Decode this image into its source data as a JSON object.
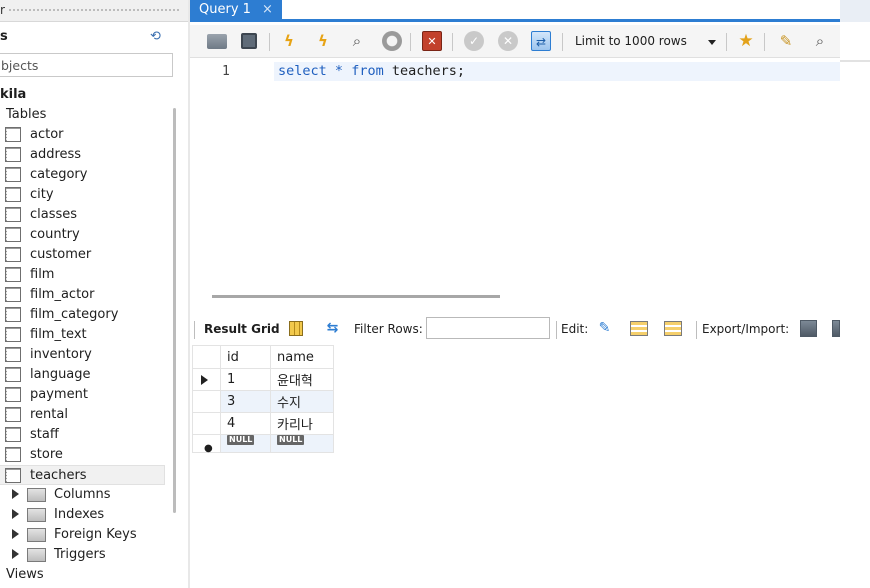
{
  "navigator": {
    "grip_title": "r",
    "header_title": "s",
    "filter_placeholder": "bjects",
    "schema_name": "kila",
    "tables_label": "Tables",
    "tables": [
      "actor",
      "address",
      "category",
      "city",
      "classes",
      "country",
      "customer",
      "film",
      "film_actor",
      "film_category",
      "film_text",
      "inventory",
      "language",
      "payment",
      "rental",
      "staff",
      "store",
      "teachers"
    ],
    "selected_table": "teachers",
    "sub_nodes": [
      "Columns",
      "Indexes",
      "Foreign Keys",
      "Triggers"
    ],
    "views_label": "Views"
  },
  "tab": {
    "title": "Query 1",
    "close": "×"
  },
  "toolbar": {
    "limit_label": "Limit to 1000 rows",
    "icons": [
      "open-folder",
      "save",
      "execute-all",
      "execute-current",
      "explain",
      "stop",
      "toggle-error-stop",
      "commit",
      "rollback",
      "autocommit-toggle",
      "add-snippet",
      "beautify",
      "find"
    ]
  },
  "editor": {
    "line_number": "1",
    "kw_select": "select",
    "star": "*",
    "kw_from": "from",
    "table": "teachers",
    "semicolon": ";"
  },
  "result": {
    "result_grid_label": "Result Grid",
    "filter_label": "Filter Rows:",
    "filter_value": "",
    "edit_label": "Edit:",
    "export_label": "Export/Import:",
    "columns": [
      "id",
      "name"
    ],
    "rows": [
      {
        "id": "1",
        "name": "윤대혁"
      },
      {
        "id": "3",
        "name": "수지"
      },
      {
        "id": "4",
        "name": "카리나"
      }
    ],
    "null_label": "NULL",
    "new_row_marker": "●"
  }
}
